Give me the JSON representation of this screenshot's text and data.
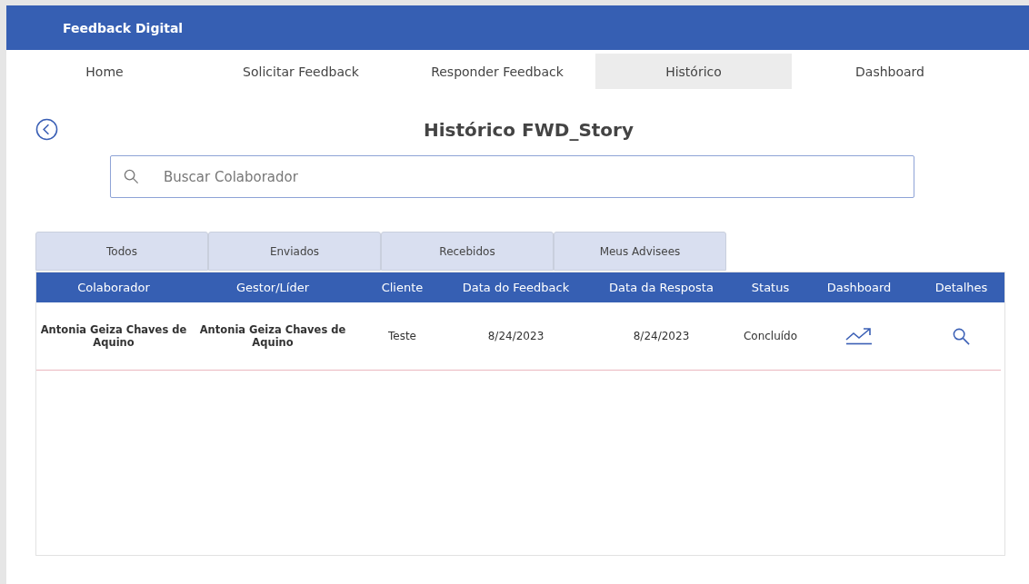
{
  "app": {
    "title": "Feedback Digital"
  },
  "nav": [
    {
      "label": "Home",
      "selected": false
    },
    {
      "label": "Solicitar Feedback",
      "selected": false
    },
    {
      "label": "Responder Feedback",
      "selected": false
    },
    {
      "label": "Histórico",
      "selected": true
    },
    {
      "label": "Dashboard",
      "selected": false
    }
  ],
  "page": {
    "title": "Histórico FWD_Story"
  },
  "search": {
    "placeholder": "Buscar Colaborador"
  },
  "filter_tabs": [
    {
      "label": "Todos",
      "selected": false
    },
    {
      "label": "Enviados",
      "selected": false
    },
    {
      "label": "Recebidos",
      "selected": false
    },
    {
      "label": "Meus Advisees",
      "selected": false
    }
  ],
  "table": {
    "columns": [
      "Colaborador",
      "Gestor/Líder",
      "Cliente",
      "Data do Feedback",
      "Data da Resposta",
      "Status",
      "Dashboard",
      "Detalhes"
    ],
    "rows": [
      {
        "colaborador": "Antonia Geiza Chaves de Aquino",
        "gestor": "Antonia Geiza Chaves de Aquino",
        "cliente": "Teste",
        "data_feedback": "8/24/2023",
        "data_resposta": "8/24/2023",
        "status": "Concluído"
      }
    ]
  }
}
